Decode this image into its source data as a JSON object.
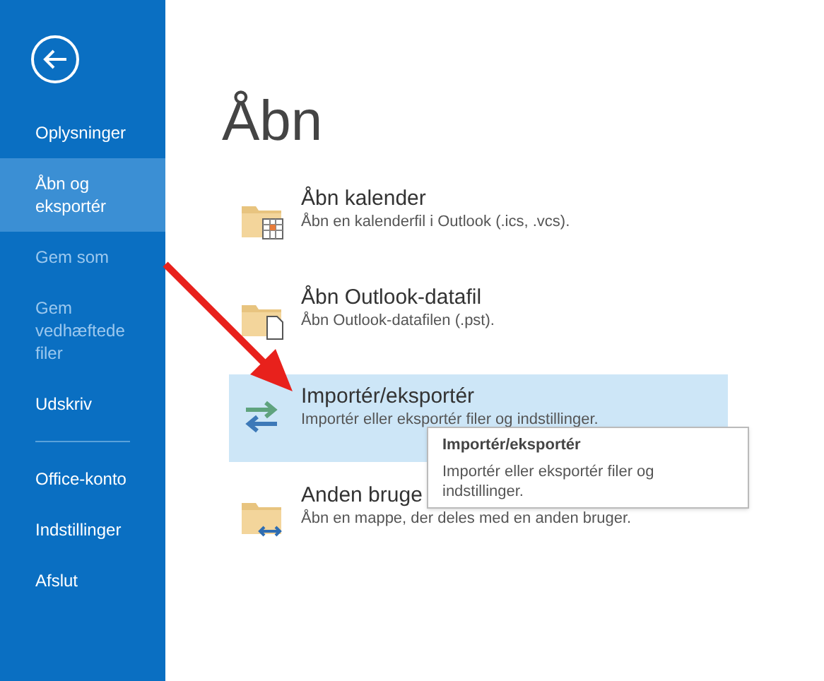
{
  "sidebar": {
    "items": [
      {
        "label": "Oplysninger",
        "selected": false,
        "disabled": false
      },
      {
        "label": "Åbn og eksportér",
        "selected": true,
        "disabled": false
      },
      {
        "label": "Gem som",
        "selected": false,
        "disabled": true
      },
      {
        "label": "Gem vedhæftede filer",
        "selected": false,
        "disabled": true
      },
      {
        "label": "Udskriv",
        "selected": false,
        "disabled": false
      }
    ],
    "bottom_items": [
      {
        "label": "Office-konto",
        "selected": false,
        "disabled": false
      },
      {
        "label": "Indstillinger",
        "selected": false,
        "disabled": false
      },
      {
        "label": "Afslut",
        "selected": false,
        "disabled": false
      }
    ]
  },
  "heading": "Åbn",
  "options": [
    {
      "kind": "calendar",
      "title": "Åbn kalender",
      "description": "Åbn en kalenderfil i Outlook (.ics, .vcs).",
      "selected": false
    },
    {
      "kind": "datafile",
      "title": "Åbn Outlook-datafil",
      "description": "Åbn Outlook-datafilen (.pst).",
      "selected": false
    },
    {
      "kind": "import",
      "title": "Importér/eksportér",
      "description": "Importér eller eksportér filer og indstillinger.",
      "selected": true
    },
    {
      "kind": "shared",
      "title": "Anden bruge",
      "description": "Åbn en mappe, der deles med en anden bruger.",
      "selected": false
    }
  ],
  "tooltip": {
    "title": "Importér/eksportér",
    "text": "Importér eller eksportér filer og indstillinger."
  }
}
